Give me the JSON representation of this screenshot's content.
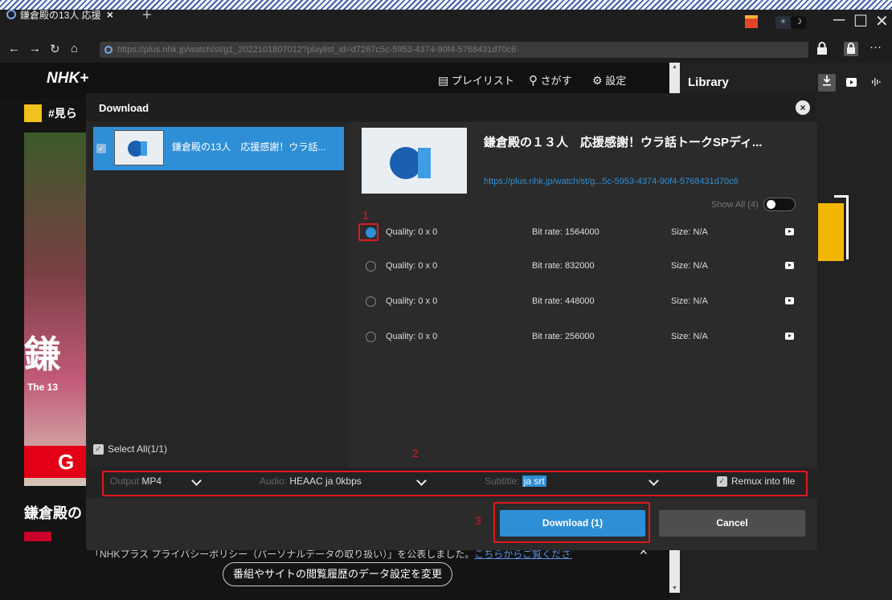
{
  "browser": {
    "tab_title": "鎌倉殿の13人 応援",
    "tab_close": "×",
    "new_tab": "+",
    "theme_sun": "☀",
    "theme_moon": "☽",
    "min": "─",
    "max": "☐",
    "close": "✕",
    "back": "←",
    "forward": "→",
    "reload": "↻",
    "home": "⌂",
    "url": "https://plus.nhk.jp/watch/st/g1_2022101807012?playlist_id=d7267c5c-5953-4374-90f4-5768431d70c6",
    "lock": "🔒",
    "more": "···"
  },
  "nhk": {
    "logo": "NHK+",
    "nav": [
      "プレイリスト",
      "さがす",
      "設定"
    ],
    "hashtag": "#見ら",
    "poster_big": "鎌",
    "poster_sub": "The 13",
    "poster_g": "G",
    "program_title": "鎌倉殿の",
    "notice_text": "「NHKプラス プライバシーポリシー（パーソナルデータの取り扱い）」を公表しました。",
    "notice_link": "こちらからご覧ください。",
    "notice_close": "✕",
    "history_button": "番組やサイトの閲覧履歴のデータ設定を変更"
  },
  "library": {
    "title": "Library",
    "icons": [
      "download-icon",
      "video-icon",
      "audio-icon"
    ]
  },
  "modal": {
    "title": "Download",
    "close": "×",
    "item_title": "鎌倉殿の13人　応援感謝！ウラ話...",
    "detail_title": "鎌倉殿の１３人　応援感謝！ウラ話トークSPディ...",
    "detail_url": "https://plus.nhk.jp/watch/st/g...5c-5953-4374-90f4-5768431d70c6",
    "show_all": "Show All (4)",
    "select_all": "Select All(1/1)",
    "qualities": [
      {
        "quality": "Quality: 0 x 0",
        "bitrate": "Bit rate: 1564000",
        "size": "Size: N/A",
        "selected": true
      },
      {
        "quality": "Quality: 0 x 0",
        "bitrate": "Bit rate: 832000",
        "size": "Size: N/A",
        "selected": false
      },
      {
        "quality": "Quality: 0 x 0",
        "bitrate": "Bit rate: 448000",
        "size": "Size: N/A",
        "selected": false
      },
      {
        "quality": "Quality: 0 x 0",
        "bitrate": "Bit rate: 256000",
        "size": "Size: N/A",
        "selected": false
      }
    ],
    "output_label": "Output",
    "output_value": "MP4",
    "audio_label": "Audio:",
    "audio_value": "HEAAC ja 0kbps",
    "subtitle_label": "Subtitle:",
    "subtitle_value": "ja srt",
    "remux_label": "Remux into file",
    "download_button": "Download (1)",
    "cancel_button": "Cancel",
    "annotations": [
      "1",
      "2",
      "3"
    ]
  },
  "colors": {
    "accent": "#2f8fd6",
    "highlight": "#e0191e"
  }
}
